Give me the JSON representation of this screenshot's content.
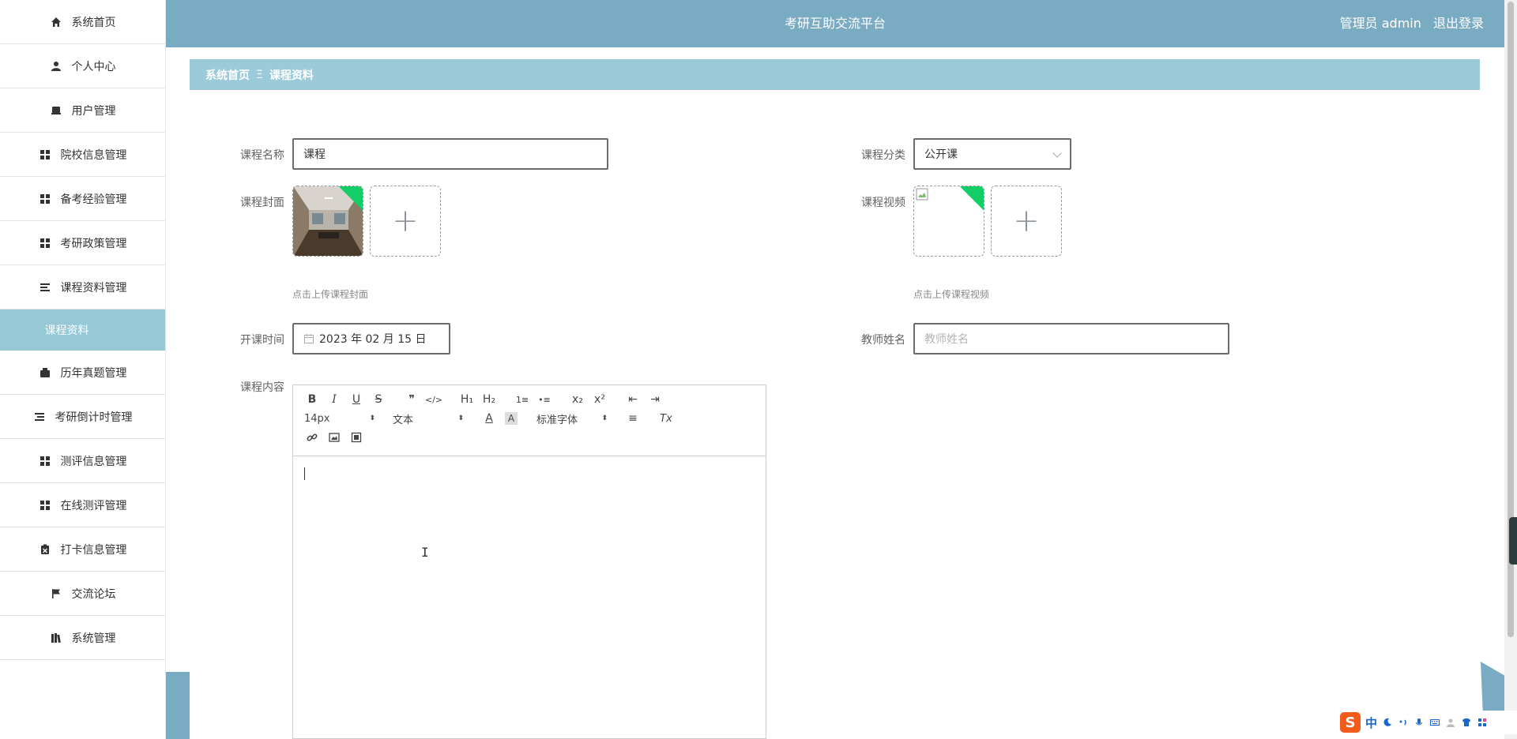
{
  "app_title": "考研互助交流平台",
  "header": {
    "user_label": "管理员 admin",
    "logout": "退出登录"
  },
  "sidebar": {
    "items": [
      {
        "label": "系统首页",
        "icon": "home-icon"
      },
      {
        "label": "个人中心",
        "icon": "person-icon"
      },
      {
        "label": "用户管理",
        "icon": "user-card-icon"
      },
      {
        "label": "院校信息管理",
        "icon": "grid-icon"
      },
      {
        "label": "备考经验管理",
        "icon": "grid-icon"
      },
      {
        "label": "考研政策管理",
        "icon": "grid-icon"
      },
      {
        "label": "课程资料管理",
        "icon": "list-icon"
      },
      {
        "label": "课程资料",
        "icon": "",
        "sub": true
      },
      {
        "label": "历年真题管理",
        "icon": "wallet-icon"
      },
      {
        "label": "考研倒计时管理",
        "icon": "list-icon"
      },
      {
        "label": "测评信息管理",
        "icon": "grid-icon"
      },
      {
        "label": "在线测评管理",
        "icon": "grid-icon"
      },
      {
        "label": "打卡信息管理",
        "icon": "clipboard-icon"
      },
      {
        "label": "交流论坛",
        "icon": "flag-icon"
      },
      {
        "label": "系统管理",
        "icon": "books-icon"
      }
    ]
  },
  "breadcrumb": {
    "home": "系统首页",
    "separator": "Ξ",
    "current": "课程资料"
  },
  "form": {
    "course_name_label": "课程名称",
    "course_name_value": "课程",
    "course_category_label": "课程分类",
    "course_category_value": "公开课",
    "cover_label": "课程封面",
    "cover_hint": "点击上传课程封面",
    "video_label": "课程视频",
    "video_hint": "点击上传课程视频",
    "start_time_label": "开课时间",
    "start_time_value": "2023 年 02 月 15 日",
    "teacher_label": "教师姓名",
    "teacher_placeholder": "教师姓名",
    "content_label": "课程内容",
    "uploader_plus": "+"
  },
  "editor": {
    "bold": "B",
    "italic": "I",
    "underline": "U",
    "strike": "S",
    "quote": "❞",
    "code": "</>",
    "h1": "H₁",
    "h2": "H₂",
    "ordered_list": "1≡",
    "bullet_list": "•≡",
    "subscript": "x₂",
    "superscript": "x²",
    "outdent": "⇤",
    "indent": "⇥",
    "font_size": "14px",
    "text_style": "文本",
    "font_family": "标准字体",
    "font_color": "A",
    "bg_color": "A",
    "align": "≡",
    "clear": "Tx",
    "caret": "⬍"
  },
  "ime": {
    "logo": "S",
    "lang": "中"
  },
  "colors": {
    "header": "#79abc2",
    "breadcrumb": "#9bcad8",
    "sidebar_active": "#96c8d6",
    "success_corner": "#13ce66"
  }
}
